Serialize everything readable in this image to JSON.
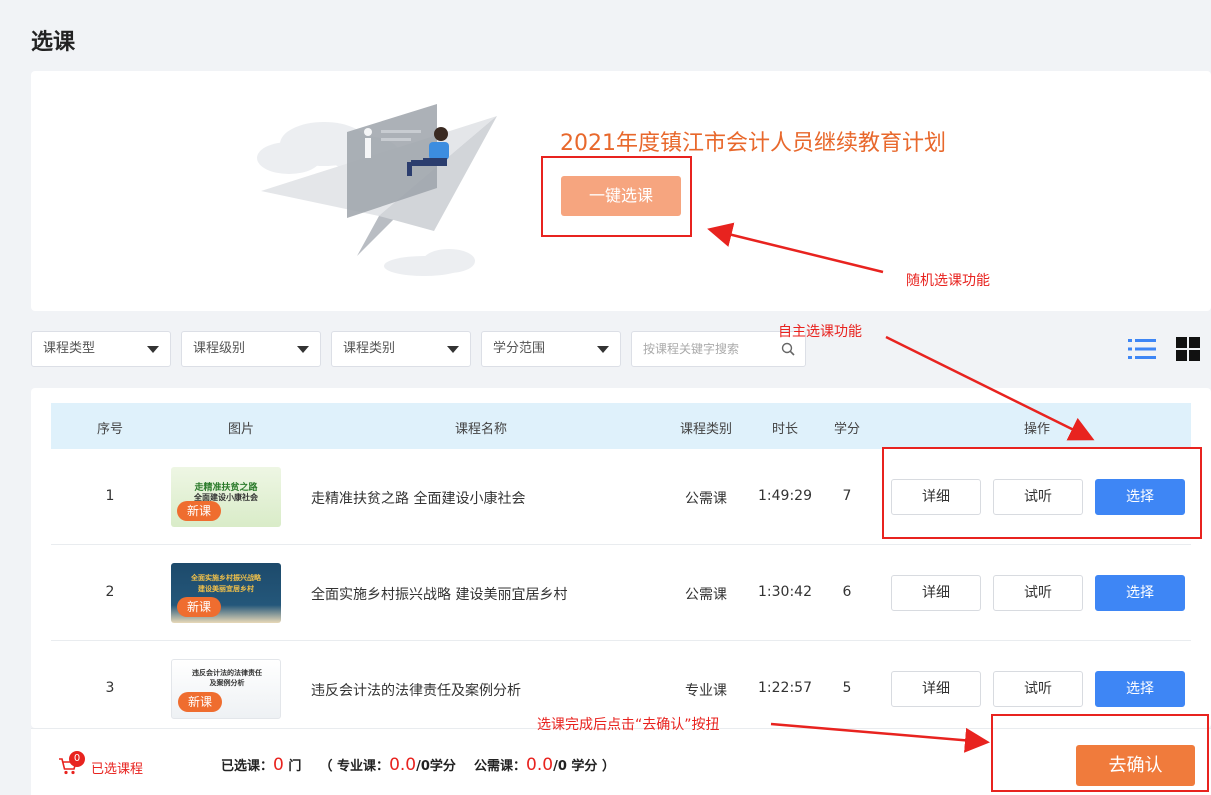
{
  "page": {
    "title": "选课"
  },
  "banner": {
    "plan_title": "2021年度镇江市会计人员继续教育计划",
    "one_click_label": "一键选课"
  },
  "annotations": {
    "random": "随机选课功能",
    "self": "自主选课功能",
    "confirm_hint": "选课完成后点击“去确认”按扭"
  },
  "filters": [
    {
      "label": "课程类型"
    },
    {
      "label": "课程级别"
    },
    {
      "label": "课程类别"
    },
    {
      "label": "学分范围"
    }
  ],
  "search": {
    "placeholder": "按课程关键字搜索",
    "value": ""
  },
  "table": {
    "headers": [
      "序号",
      "图片",
      "课程名称",
      "课程类别",
      "时长",
      "学分",
      "操作"
    ],
    "rows": [
      {
        "index": "1",
        "thumb_lines": [
          "走精准扶贫之路",
          "全面建设小康社会"
        ],
        "badge": "新课",
        "name": "走精准扶贫之路 全面建设小康社会",
        "category": "公需课",
        "duration": "1:49:29",
        "credit": "7"
      },
      {
        "index": "2",
        "thumb_lines": [
          "全面实施乡村振兴战略",
          "建设美丽宜居乡村"
        ],
        "badge": "新课",
        "name": "全面实施乡村振兴战略 建设美丽宜居乡村",
        "category": "公需课",
        "duration": "1:30:42",
        "credit": "6"
      },
      {
        "index": "3",
        "thumb_lines": [
          "违反会计法的法律责任",
          "及案例分析"
        ],
        "badge": "新课",
        "name": "违反会计法的法律责任及案例分析",
        "category": "专业课",
        "duration": "1:22:57",
        "credit": "5"
      }
    ],
    "actions": {
      "detail": "详细",
      "trial": "试听",
      "select": "选择"
    }
  },
  "footer": {
    "cart_count": "0",
    "cart_label": "已选课程",
    "selected_label": "已选课：",
    "selected_count": "0",
    "selected_unit": "门",
    "open_paren": "（",
    "pro_label": "专业课：",
    "pro_credit": "0.0",
    "pro_suffix": "/0学分",
    "public_label": "公需课：",
    "public_credit": "0.0",
    "public_suffix": "/0 学分",
    "close_paren": "）",
    "confirm_label": "去确认"
  },
  "colors": {
    "accent_orange": "#f07b3c",
    "primary_blue": "#3e86f5",
    "annotation_red": "#e8231f",
    "header_blue": "#dff1fb"
  },
  "icons": [
    "search-icon",
    "list-view-icon",
    "grid-view-icon",
    "cart-icon",
    "caret-down-icon"
  ]
}
